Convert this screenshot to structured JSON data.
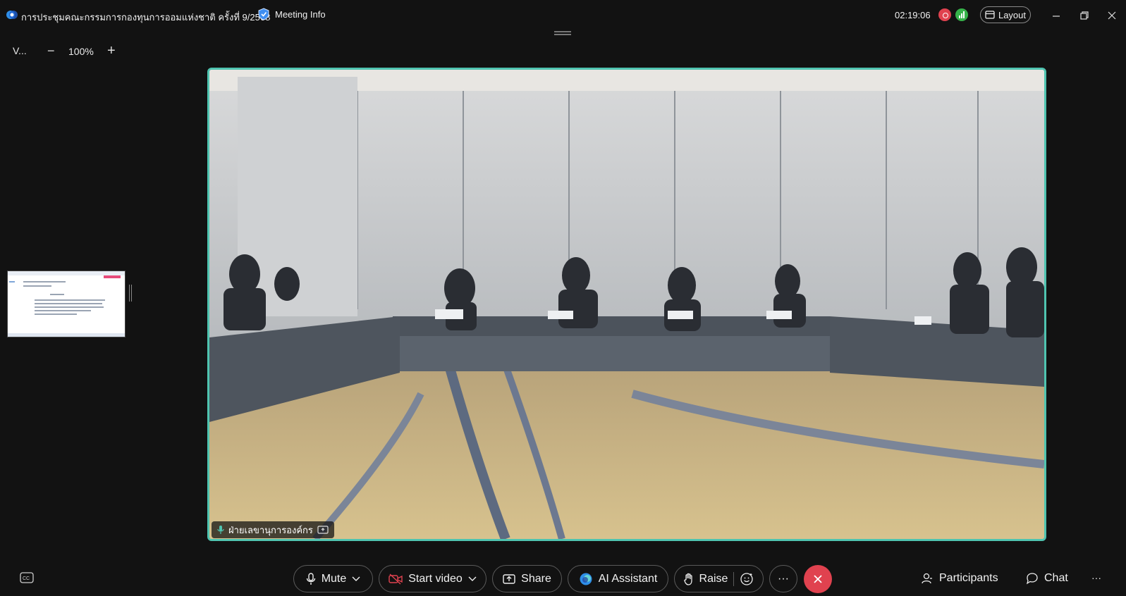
{
  "titlebar": {
    "meeting_title": "การประชุมคณะกรรมการกองทุนการออมแห่งชาติ ครั้งที่ 9/2568",
    "meeting_info_label": "Meeting Info",
    "timer": "02:19:06",
    "layout_label": "Layout",
    "icons": [
      "app-logo-icon",
      "shield-icon",
      "record-icon",
      "signal-icon",
      "layout-icon",
      "minimize-icon",
      "restore-icon",
      "close-icon"
    ]
  },
  "zoom": {
    "view_label": "V...",
    "minus": "−",
    "level": "100%",
    "plus": "+"
  },
  "video": {
    "participant_name": "ฝ่ายเลขานุการองค์กร"
  },
  "controls": {
    "mute_label": "Mute",
    "start_video_label": "Start video",
    "share_label": "Share",
    "ai_assistant_label": "AI Assistant",
    "raise_label": "Raise",
    "more_label": "···",
    "participants_label": "Participants",
    "chat_label": "Chat",
    "overflow_label": "···"
  },
  "colors": {
    "background": "#121212",
    "active_speaker_border": "#4fc4b0",
    "end_call": "#e0424f",
    "video_off": "#e0424f",
    "signal": "#36b24a"
  }
}
